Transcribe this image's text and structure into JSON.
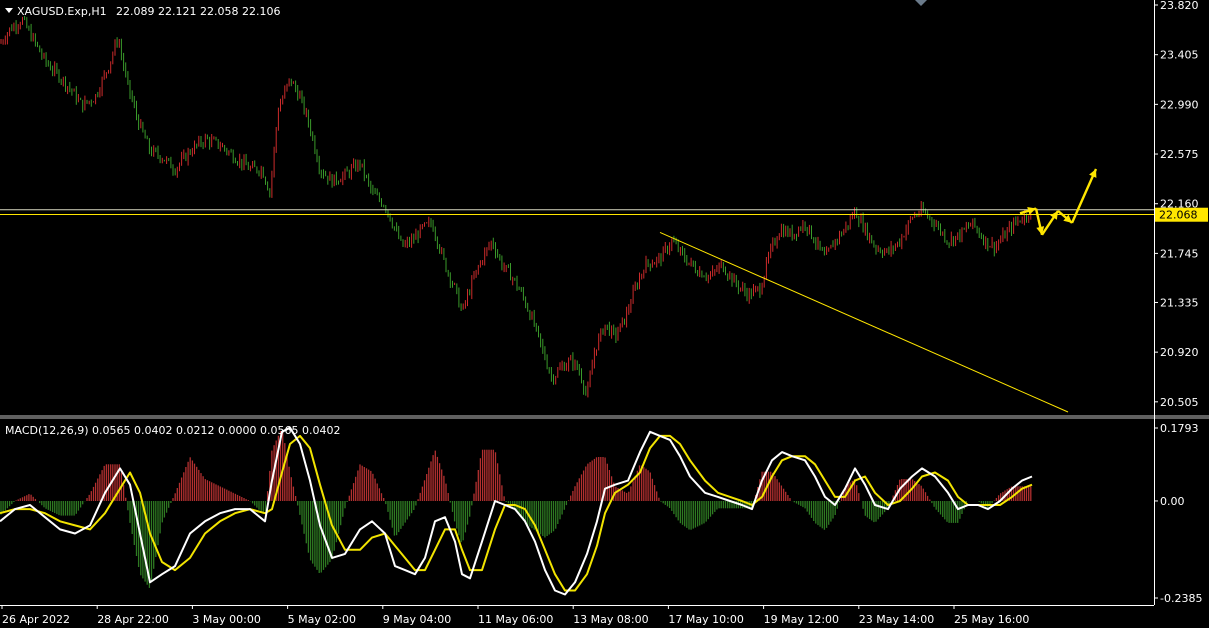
{
  "header": {
    "symbol": "XAGUSD.Exp,H1",
    "ohlc": "22.089 22.121 22.058 22.106"
  },
  "macd_header": "MACD(12,26,9) 0.0565 0.0402 0.0212 0.0000 0.0565 0.0402",
  "colors": {
    "background": "#000000",
    "bull": "#cc2b2b",
    "bear": "#3a9a2a",
    "hist_pos": "#b33030",
    "hist_neg": "#2e7a22",
    "macd_line": "#ffffff",
    "signal_line": "#f2e400",
    "price_line": "#ffe600",
    "arrow": "#ffe600",
    "axis": "#ffffff",
    "separator": "#c0c0c0"
  },
  "chart_data": [
    {
      "type": "candlestick",
      "title": "XAGUSD.Exp,H1",
      "ylim": [
        20.42,
        23.82
      ],
      "y_ticks": [
        "23.820",
        "23.405",
        "22.990",
        "22.575",
        "22.160",
        "21.745",
        "21.335",
        "20.920",
        "20.505"
      ],
      "current_price": "22.068",
      "x_ticks": [
        "26 Apr 2022",
        "28 Apr 22:00",
        "3 May 00:00",
        "5 May 02:00",
        "9 May 04:00",
        "11 May 06:00",
        "13 May 08:00",
        "17 May 10:00",
        "19 May 12:00",
        "23 May 14:00",
        "25 May 16:00"
      ],
      "close_path": [
        [
          0,
          23.5
        ],
        [
          10,
          23.62
        ],
        [
          22,
          23.7
        ],
        [
          32,
          23.55
        ],
        [
          45,
          23.35
        ],
        [
          60,
          23.22
        ],
        [
          72,
          23.1
        ],
        [
          82,
          22.98
        ],
        [
          95,
          23.05
        ],
        [
          108,
          23.3
        ],
        [
          118,
          23.55
        ],
        [
          126,
          23.2
        ],
        [
          138,
          22.85
        ],
        [
          150,
          22.6
        ],
        [
          162,
          22.55
        ],
        [
          175,
          22.45
        ],
        [
          190,
          22.6
        ],
        [
          205,
          22.7
        ],
        [
          220,
          22.65
        ],
        [
          235,
          22.55
        ],
        [
          250,
          22.45
        ],
        [
          262,
          22.45
        ],
        [
          270,
          22.25
        ],
        [
          278,
          22.95
        ],
        [
          290,
          23.2
        ],
        [
          300,
          23.05
        ],
        [
          310,
          22.8
        ],
        [
          320,
          22.45
        ],
        [
          332,
          22.35
        ],
        [
          345,
          22.4
        ],
        [
          360,
          22.5
        ],
        [
          372,
          22.25
        ],
        [
          385,
          22.15
        ],
        [
          395,
          21.95
        ],
        [
          402,
          21.8
        ],
        [
          412,
          21.85
        ],
        [
          422,
          21.95
        ],
        [
          432,
          22.0
        ],
        [
          445,
          21.65
        ],
        [
          455,
          21.45
        ],
        [
          462,
          21.25
        ],
        [
          472,
          21.5
        ],
        [
          482,
          21.7
        ],
        [
          492,
          21.85
        ],
        [
          502,
          21.65
        ],
        [
          512,
          21.55
        ],
        [
          522,
          21.4
        ],
        [
          532,
          21.2
        ],
        [
          542,
          20.95
        ],
        [
          552,
          20.7
        ],
        [
          562,
          20.8
        ],
        [
          572,
          20.85
        ],
        [
          580,
          20.75
        ],
        [
          587,
          20.55
        ],
        [
          595,
          20.95
        ],
        [
          605,
          21.15
        ],
        [
          615,
          21.05
        ],
        [
          625,
          21.2
        ],
        [
          635,
          21.45
        ],
        [
          645,
          21.65
        ],
        [
          660,
          21.7
        ],
        [
          672,
          21.85
        ],
        [
          685,
          21.7
        ],
        [
          698,
          21.6
        ],
        [
          710,
          21.55
        ],
        [
          722,
          21.65
        ],
        [
          735,
          21.5
        ],
        [
          748,
          21.4
        ],
        [
          760,
          21.45
        ],
        [
          770,
          21.75
        ],
        [
          780,
          21.95
        ],
        [
          792,
          21.9
        ],
        [
          805,
          22.0
        ],
        [
          815,
          21.85
        ],
        [
          825,
          21.7
        ],
        [
          835,
          21.85
        ],
        [
          845,
          21.95
        ],
        [
          855,
          22.1
        ],
        [
          865,
          21.95
        ],
        [
          875,
          21.8
        ],
        [
          888,
          21.75
        ],
        [
          900,
          21.85
        ],
        [
          912,
          22.05
        ],
        [
          922,
          22.1
        ],
        [
          935,
          22.0
        ],
        [
          948,
          21.85
        ],
        [
          960,
          21.9
        ],
        [
          972,
          22.0
        ],
        [
          985,
          21.85
        ],
        [
          995,
          21.8
        ],
        [
          1005,
          21.9
        ],
        [
          1015,
          22.0
        ],
        [
          1025,
          22.06
        ],
        [
          1032,
          22.1
        ]
      ],
      "annotations": [
        {
          "type": "horizontal_line",
          "y": 22.07
        },
        {
          "type": "horizontal_line",
          "y": 22.11
        },
        {
          "type": "trend_line",
          "from": [
            660,
            21.92
          ],
          "to": [
            1068,
            20.42
          ]
        },
        {
          "type": "arrow_path",
          "points": [
            [
              1020,
              22.08
            ],
            [
              1036,
              22.12
            ],
            [
              1042,
              21.9
            ],
            [
              1058,
              22.1
            ],
            [
              1072,
              22.0
            ],
            [
              1096,
              22.45
            ]
          ]
        }
      ]
    },
    {
      "type": "bar+line",
      "title": "MACD(12,26,9)",
      "ylim": [
        -0.2385,
        0.1793
      ],
      "y_ticks": [
        "0.1793",
        "0.00",
        "-0.2385"
      ],
      "macd": [
        [
          0,
          -0.05
        ],
        [
          15,
          -0.02
        ],
        [
          30,
          -0.01
        ],
        [
          45,
          -0.04
        ],
        [
          60,
          -0.07
        ],
        [
          75,
          -0.08
        ],
        [
          90,
          -0.06
        ],
        [
          105,
          0.02
        ],
        [
          120,
          0.08
        ],
        [
          130,
          0.04
        ],
        [
          140,
          -0.08
        ],
        [
          150,
          -0.2
        ],
        [
          162,
          -0.18
        ],
        [
          175,
          -0.16
        ],
        [
          190,
          -0.08
        ],
        [
          205,
          -0.05
        ],
        [
          220,
          -0.03
        ],
        [
          235,
          -0.02
        ],
        [
          250,
          -0.02
        ],
        [
          265,
          -0.05
        ],
        [
          272,
          0.05
        ],
        [
          282,
          0.17
        ],
        [
          290,
          0.18
        ],
        [
          300,
          0.14
        ],
        [
          310,
          0.05
        ],
        [
          320,
          -0.06
        ],
        [
          332,
          -0.14
        ],
        [
          345,
          -0.13
        ],
        [
          360,
          -0.07
        ],
        [
          372,
          -0.05
        ],
        [
          385,
          -0.08
        ],
        [
          395,
          -0.16
        ],
        [
          405,
          -0.17
        ],
        [
          415,
          -0.18
        ],
        [
          425,
          -0.14
        ],
        [
          435,
          -0.05
        ],
        [
          445,
          -0.04
        ],
        [
          455,
          -0.1
        ],
        [
          462,
          -0.18
        ],
        [
          470,
          -0.19
        ],
        [
          482,
          -0.1
        ],
        [
          495,
          0.0
        ],
        [
          505,
          -0.01
        ],
        [
          515,
          -0.02
        ],
        [
          525,
          -0.05
        ],
        [
          535,
          -0.1
        ],
        [
          545,
          -0.17
        ],
        [
          555,
          -0.22
        ],
        [
          565,
          -0.23
        ],
        [
          575,
          -0.2
        ],
        [
          587,
          -0.13
        ],
        [
          597,
          -0.05
        ],
        [
          605,
          0.03
        ],
        [
          615,
          0.04
        ],
        [
          628,
          0.05
        ],
        [
          640,
          0.12
        ],
        [
          650,
          0.17
        ],
        [
          660,
          0.16
        ],
        [
          670,
          0.15
        ],
        [
          680,
          0.11
        ],
        [
          690,
          0.06
        ],
        [
          705,
          0.02
        ],
        [
          718,
          0.01
        ],
        [
          730,
          0.0
        ],
        [
          742,
          -0.01
        ],
        [
          752,
          -0.02
        ],
        [
          762,
          0.05
        ],
        [
          772,
          0.1
        ],
        [
          782,
          0.12
        ],
        [
          792,
          0.11
        ],
        [
          805,
          0.1
        ],
        [
          815,
          0.06
        ],
        [
          825,
          0.01
        ],
        [
          835,
          -0.01
        ],
        [
          845,
          0.03
        ],
        [
          855,
          0.08
        ],
        [
          865,
          0.04
        ],
        [
          875,
          -0.01
        ],
        [
          888,
          -0.02
        ],
        [
          900,
          0.03
        ],
        [
          912,
          0.06
        ],
        [
          922,
          0.08
        ],
        [
          935,
          0.06
        ],
        [
          948,
          0.02
        ],
        [
          958,
          -0.02
        ],
        [
          968,
          -0.01
        ],
        [
          978,
          -0.01
        ],
        [
          988,
          -0.02
        ],
        [
          1000,
          0.0
        ],
        [
          1012,
          0.03
        ],
        [
          1022,
          0.05
        ],
        [
          1032,
          0.06
        ]
      ],
      "signal": [
        [
          0,
          -0.03
        ],
        [
          15,
          -0.02
        ],
        [
          30,
          -0.02
        ],
        [
          45,
          -0.03
        ],
        [
          60,
          -0.05
        ],
        [
          75,
          -0.06
        ],
        [
          90,
          -0.07
        ],
        [
          105,
          -0.03
        ],
        [
          120,
          0.03
        ],
        [
          130,
          0.07
        ],
        [
          140,
          0.02
        ],
        [
          150,
          -0.08
        ],
        [
          162,
          -0.15
        ],
        [
          175,
          -0.17
        ],
        [
          190,
          -0.14
        ],
        [
          205,
          -0.08
        ],
        [
          220,
          -0.05
        ],
        [
          235,
          -0.03
        ],
        [
          250,
          -0.02
        ],
        [
          265,
          -0.03
        ],
        [
          272,
          -0.02
        ],
        [
          282,
          0.07
        ],
        [
          290,
          0.14
        ],
        [
          300,
          0.16
        ],
        [
          310,
          0.13
        ],
        [
          320,
          0.04
        ],
        [
          332,
          -0.06
        ],
        [
          345,
          -0.12
        ],
        [
          360,
          -0.12
        ],
        [
          372,
          -0.09
        ],
        [
          385,
          -0.08
        ],
        [
          395,
          -0.11
        ],
        [
          405,
          -0.14
        ],
        [
          415,
          -0.17
        ],
        [
          425,
          -0.17
        ],
        [
          435,
          -0.12
        ],
        [
          445,
          -0.07
        ],
        [
          455,
          -0.07
        ],
        [
          462,
          -0.12
        ],
        [
          470,
          -0.17
        ],
        [
          482,
          -0.17
        ],
        [
          495,
          -0.07
        ],
        [
          505,
          -0.01
        ],
        [
          515,
          -0.01
        ],
        [
          525,
          -0.02
        ],
        [
          535,
          -0.06
        ],
        [
          545,
          -0.12
        ],
        [
          555,
          -0.18
        ],
        [
          565,
          -0.22
        ],
        [
          575,
          -0.22
        ],
        [
          587,
          -0.18
        ],
        [
          597,
          -0.11
        ],
        [
          605,
          -0.03
        ],
        [
          615,
          0.02
        ],
        [
          628,
          0.04
        ],
        [
          640,
          0.07
        ],
        [
          650,
          0.13
        ],
        [
          660,
          0.16
        ],
        [
          670,
          0.16
        ],
        [
          680,
          0.14
        ],
        [
          690,
          0.1
        ],
        [
          705,
          0.05
        ],
        [
          718,
          0.02
        ],
        [
          730,
          0.01
        ],
        [
          742,
          0.0
        ],
        [
          752,
          -0.01
        ],
        [
          762,
          0.01
        ],
        [
          772,
          0.06
        ],
        [
          782,
          0.1
        ],
        [
          792,
          0.11
        ],
        [
          805,
          0.11
        ],
        [
          815,
          0.09
        ],
        [
          825,
          0.05
        ],
        [
          835,
          0.01
        ],
        [
          845,
          0.01
        ],
        [
          855,
          0.05
        ],
        [
          865,
          0.06
        ],
        [
          875,
          0.02
        ],
        [
          888,
          -0.01
        ],
        [
          900,
          0.0
        ],
        [
          912,
          0.03
        ],
        [
          922,
          0.06
        ],
        [
          935,
          0.07
        ],
        [
          948,
          0.05
        ],
        [
          958,
          0.01
        ],
        [
          968,
          -0.01
        ],
        [
          978,
          -0.01
        ],
        [
          988,
          -0.01
        ],
        [
          1000,
          -0.01
        ],
        [
          1012,
          0.01
        ],
        [
          1022,
          0.03
        ],
        [
          1032,
          0.04
        ]
      ]
    }
  ]
}
